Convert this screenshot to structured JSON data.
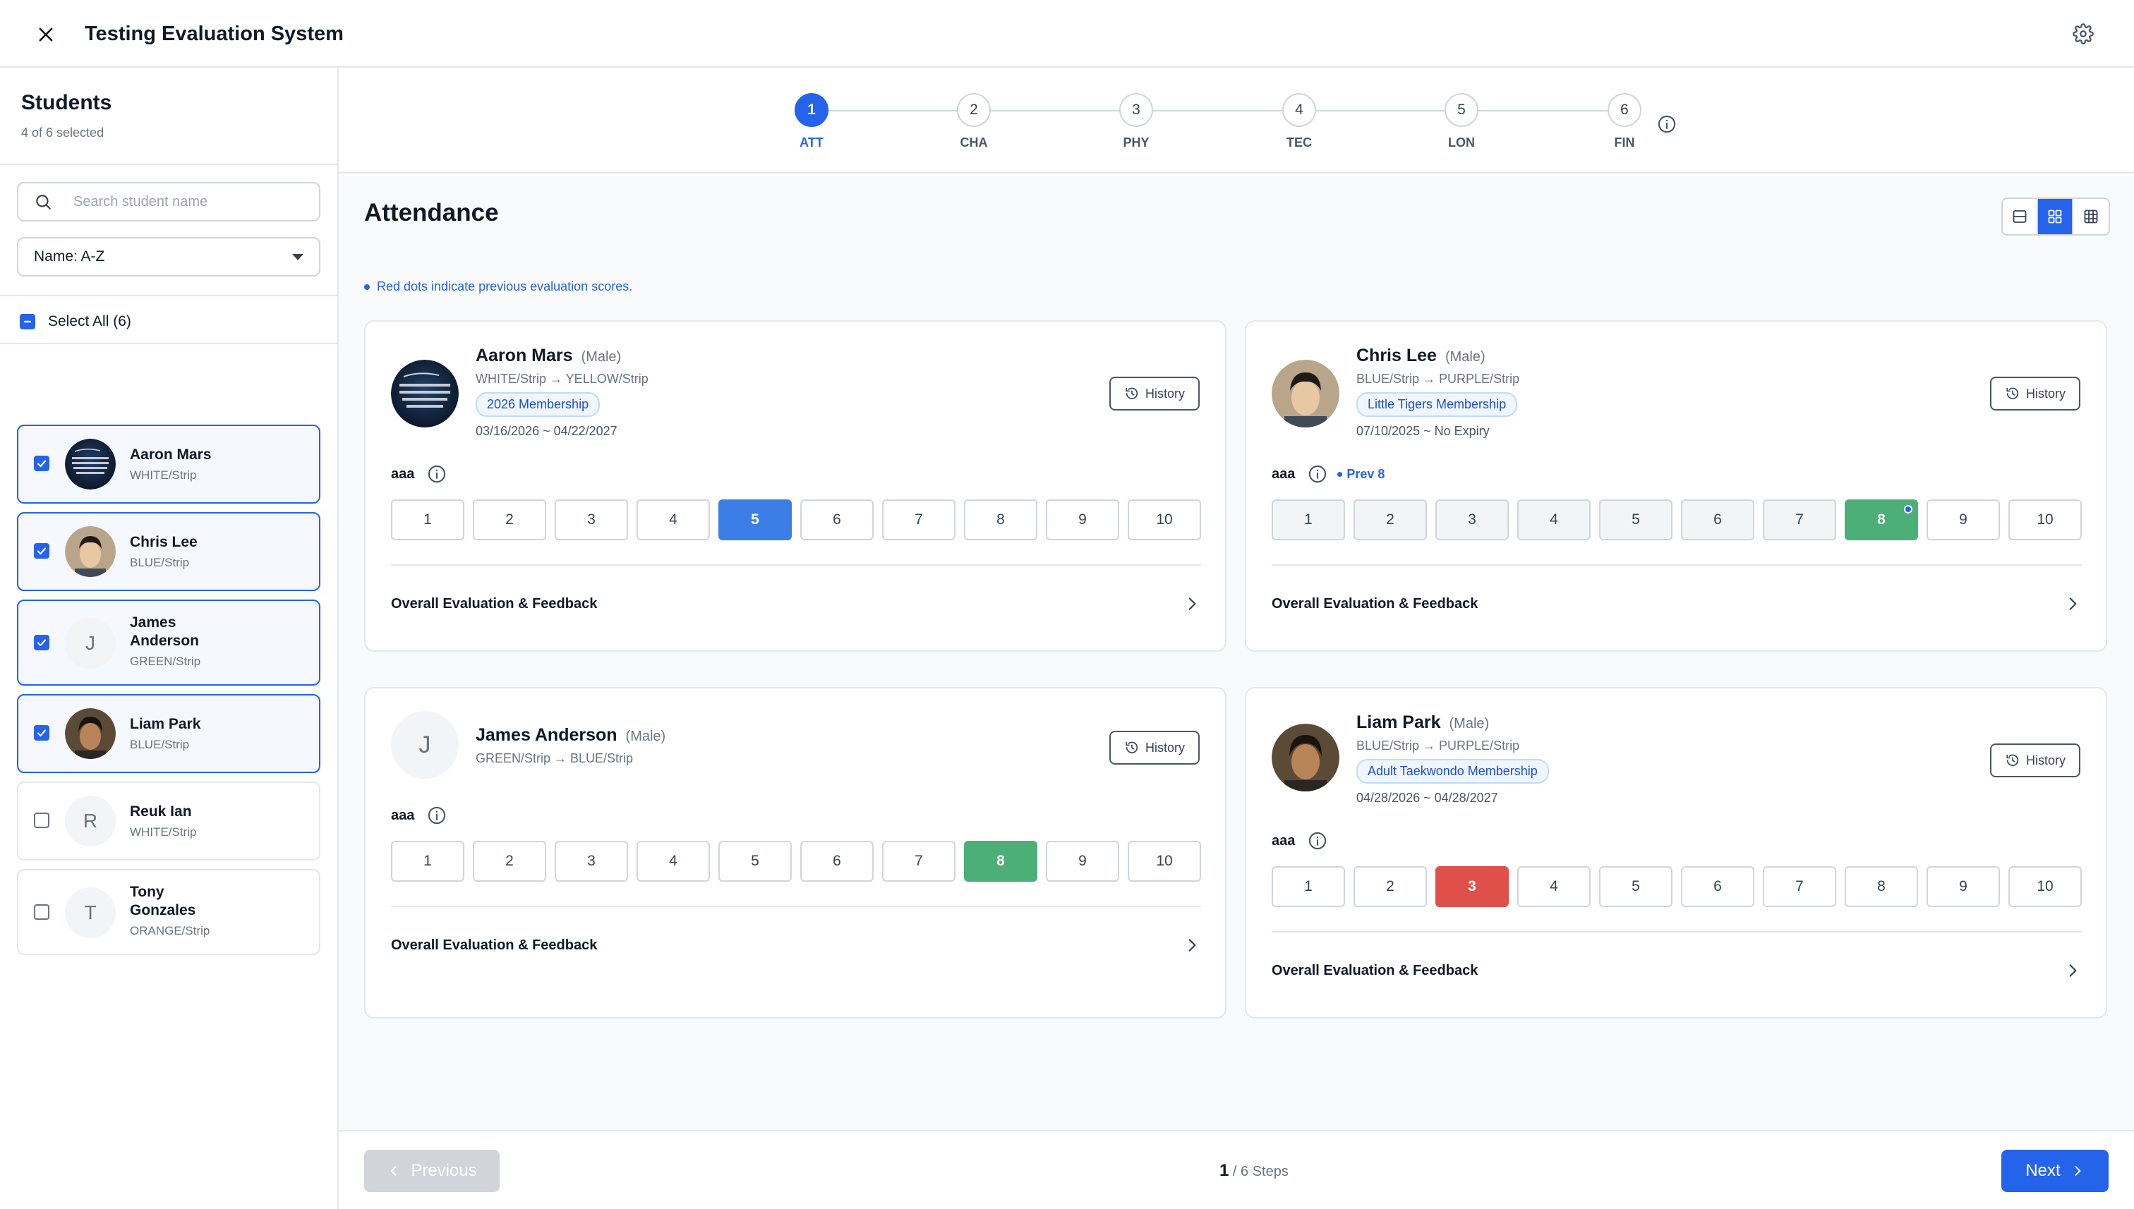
{
  "app": {
    "title": "Testing Evaluation System"
  },
  "sidebar": {
    "title": "Students",
    "selected_count": "4 of 6 selected",
    "search_placeholder": "Search student name",
    "sort": {
      "selected": "Name: A-Z"
    },
    "select_all_label": "Select All (6)",
    "students": [
      {
        "name": "Aaron Mars",
        "belt": "WHITE/Strip",
        "selected": true,
        "avatar": "photo"
      },
      {
        "name": "Chris Lee",
        "belt": "BLUE/Strip",
        "selected": true,
        "avatar": "photo"
      },
      {
        "name": "James Anderson",
        "name_line1": "James",
        "name_line2": "Anderson",
        "belt": "GREEN/Strip",
        "selected": true,
        "avatar": "J"
      },
      {
        "name": "Liam Park",
        "belt": "BLUE/Strip",
        "selected": true,
        "avatar": "photo"
      },
      {
        "name": "Reuk Ian",
        "belt": "WHITE/Strip",
        "selected": false,
        "avatar": "R"
      },
      {
        "name": "Tony Gonzales",
        "name_line1": "Tony",
        "name_line2": "Gonzales",
        "belt": "ORANGE/Strip",
        "selected": false,
        "avatar": "T"
      }
    ]
  },
  "stepper": {
    "steps": [
      {
        "num": "1",
        "code": "ATT",
        "active": true
      },
      {
        "num": "2",
        "code": "CHA",
        "active": false
      },
      {
        "num": "3",
        "code": "PHY",
        "active": false
      },
      {
        "num": "4",
        "code": "TEC",
        "active": false
      },
      {
        "num": "5",
        "code": "LON",
        "active": false
      },
      {
        "num": "6",
        "code": "FIN",
        "active": false
      }
    ]
  },
  "main": {
    "section_title": "Attendance",
    "hint": "Red dots indicate previous evaluation scores.",
    "view_mode": "grid",
    "history_label": "History",
    "feedback_label": "Overall Evaluation & Feedback",
    "score_options": [
      "1",
      "2",
      "3",
      "4",
      "5",
      "6",
      "7",
      "8",
      "9",
      "10"
    ],
    "cards": [
      {
        "name": "Aaron Mars",
        "gender": "(Male)",
        "belt": "WHITE/Strip → YELLOW/Strip",
        "membership": "2026 Membership",
        "dates": "03/16/2026 ~ 04/22/2027",
        "criterion": "aaa",
        "prev": "",
        "selected_score": 5,
        "score_color": "blue"
      },
      {
        "name": "Chris Lee",
        "gender": "(Male)",
        "belt": "BLUE/Strip → PURPLE/Strip",
        "membership": "Little Tigers Membership",
        "dates": "07/10/2025 ~ No Expiry",
        "criterion": "aaa",
        "prev": "Prev 8",
        "selected_score": 8,
        "score_color": "green"
      },
      {
        "name": "James Anderson",
        "gender": "(Male)",
        "belt": "GREEN/Strip → BLUE/Strip",
        "membership": "",
        "dates": "",
        "criterion": "aaa",
        "prev": "",
        "selected_score": 8,
        "score_color": "green",
        "avatar_letter": "J"
      },
      {
        "name": "Liam Park",
        "gender": "(Male)",
        "belt": "BLUE/Strip → PURPLE/Strip",
        "membership": "Adult Taekwondo Membership",
        "dates": "04/28/2026 ~ 04/28/2027",
        "criterion": "aaa",
        "prev": "",
        "selected_score": 3,
        "score_color": "red"
      }
    ]
  },
  "footer": {
    "previous_label": "Previous",
    "next_label": "Next",
    "current_step": "1",
    "total_steps": "/ 6 Steps"
  },
  "colors": {
    "accent": "#2563eb",
    "score_blue": "#3b7fe6",
    "score_green": "#4caf78",
    "score_red": "#e0504a"
  }
}
